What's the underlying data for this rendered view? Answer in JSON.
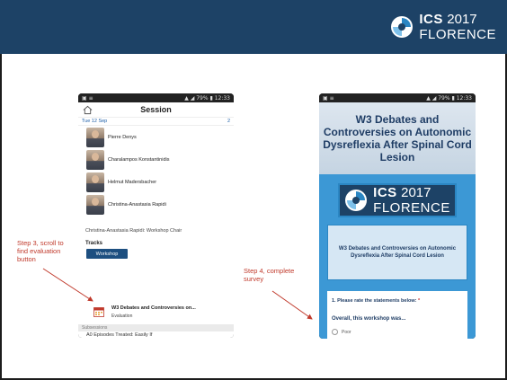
{
  "brand": {
    "ics": "ICS",
    "year": "2017",
    "city": "FLORENCE"
  },
  "phone1": {
    "status_time": "12:33",
    "status_battery": "79%",
    "title": "Session",
    "date": "Tue 12 Sep",
    "date_count": "2",
    "people": [
      "Pierre Denys",
      "Charalampos Konstantinidis",
      "Helmut Madersbacher",
      "Christina-Anastasia Rapidi"
    ],
    "chair_line": "Christina-Anastasia Rapidi: Workshop Chair",
    "tracks_label": "Tracks",
    "track_button": "Workshop",
    "eval_title": "W3 Debates and Controversies on...",
    "eval_sub": "Evaluation",
    "subsessions": "Subsessions",
    "subsession_item": "A0 Episodes Treated: Easily If"
  },
  "phone2": {
    "status_time": "12:33",
    "status_battery": "79%",
    "hero_title": "W3 Debates and Controversies on Autonomic Dysreflexia After Spinal Cord Lesion",
    "card_text": "W3 Debates and Controversies on Autonomic Dysreflexia After Spinal Cord Lesion",
    "q_label": "1. Please rate the statements below:",
    "q_required": "*",
    "q_sub": "Overall, this workshop was...",
    "option_first": "Poor"
  },
  "callouts": {
    "step3": "Step 3, scroll to find evaluation button",
    "step4": "Step 4, complete survey"
  },
  "colors": {
    "banner": "#1d4266",
    "accent_blue": "#3c98d5",
    "callout_red": "#c0392b"
  }
}
